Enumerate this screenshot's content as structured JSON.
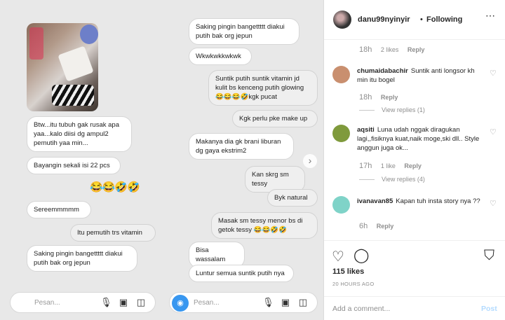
{
  "left_chat": {
    "messages": [
      "Btw...itu tubuh gak rusak apa yaa...kalo diisi dg ampul2 pemutih yaa min...",
      "Bayangin sekali isi 22 pcs",
      "Sereemmmmm",
      "Itu pemutih trs vitamin",
      "Saking pingin bangettttt diakui putih bak org jepun"
    ],
    "emoji": "😂😂🤣🤣",
    "input_placeholder": "Pesan..."
  },
  "right_chat": {
    "messages": [
      "Saking pingin bangettttt diakui putih bak org jepun",
      "Wkwkwkkwkwk",
      "Suntik putih suntik vitamin jd kulit bs kenceng putih glowing 😂😂😂🤣kgk pucat",
      "Kgk perlu pke make up",
      "Makanya dia gk brani liburan dg gaya ekstrim2",
      "Kan skrg sm tessy",
      "Byk natural",
      "Masak sm tessy menor bs di getok tessy 😂😂🤣🤣",
      "Bisa wassalam",
      "Luntur semua suntik putih nya"
    ],
    "input_placeholder": "Pesan..."
  },
  "header": {
    "username": "danu99nyinyir",
    "separator": "•",
    "follow_status": "Following"
  },
  "top_meta": {
    "time": "18h",
    "likes": "2 likes",
    "reply": "Reply"
  },
  "comments": [
    {
      "username": "chumaidabachir",
      "text": "Suntik anti longsor kh min itu bogel",
      "time": "18h",
      "likes": "",
      "reply": "Reply",
      "view_replies": "View replies (1)",
      "avatar_color": "#c98f6f"
    },
    {
      "username": "aqsiti",
      "text": "Luna udah nggak diragukan lagi,,fisiknya kuat,naik moge,ski dll.. Style anggun juga ok...",
      "time": "17h",
      "likes": "1 like",
      "reply": "Reply",
      "view_replies": "View replies (4)",
      "avatar_color": "#7f9a3c"
    },
    {
      "username": "ivanavan85",
      "text": "Kapan tuh insta story nya ??",
      "time": "6h",
      "likes": "",
      "reply": "Reply",
      "view_replies": "",
      "avatar_color": "#7fd3c8"
    }
  ],
  "likes_count": "115 likes",
  "posted_time": "20 HOURS AGO",
  "add_comment": {
    "placeholder": "Add a comment...",
    "post_label": "Post"
  },
  "icons": {
    "like": "heart-icon",
    "comment": "comment-icon",
    "save": "bookmark-icon",
    "more": "more-icon",
    "camera": "camera-icon",
    "mic": "mic-icon",
    "gallery": "gallery-icon",
    "sticker": "sticker-icon",
    "next": "chevron-right-icon"
  },
  "colors": {
    "accent": "#3897f0",
    "post_disabled": "#b3dbff",
    "muted": "#8e8e8e"
  }
}
